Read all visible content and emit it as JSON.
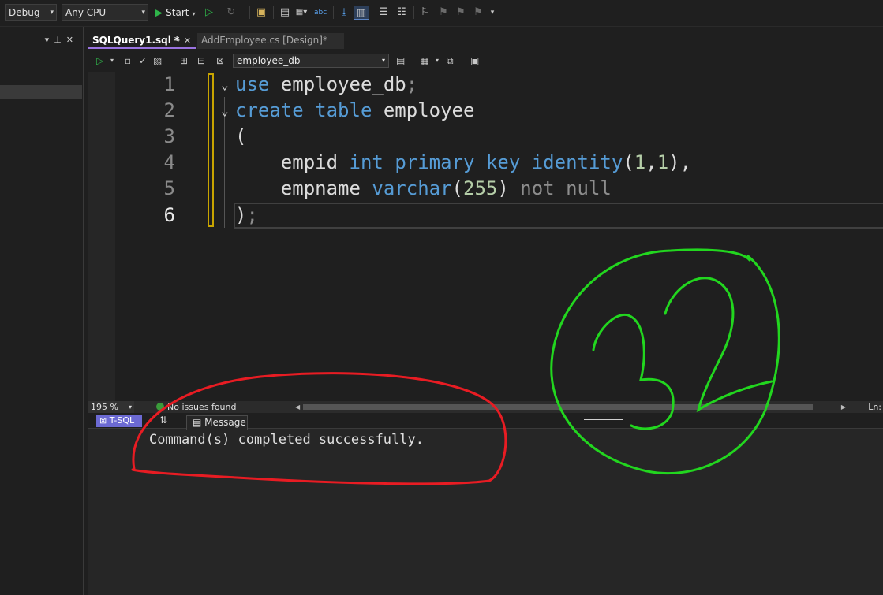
{
  "toolbar": {
    "config": "Debug",
    "platform": "Any CPU",
    "start_label": "Start"
  },
  "tabs": [
    {
      "label": "SQLQuery1.sql *",
      "active": true
    },
    {
      "label": "AddEmployee.cs [Design]*",
      "active": false
    }
  ],
  "query_toolbar": {
    "database": "employee_db"
  },
  "editor": {
    "line_numbers": [
      "1",
      "2",
      "3",
      "4",
      "5",
      "6"
    ],
    "current_line": 6,
    "lines": [
      "use employee_db;",
      "create table employee",
      "(",
      "    empid int primary key identity(1,1),",
      "    empname varchar(255) not null",
      ");"
    ]
  },
  "status": {
    "zoom": "195 %",
    "issues": "No issues found",
    "position_label": "Ln:"
  },
  "results": {
    "tsql_tab": "T-SQL",
    "message_tab": "Message",
    "message": "Command(s) completed successfully."
  },
  "annotation_text": "32",
  "colors": {
    "accent": "#9a73e0",
    "keyword": "#569cd6",
    "number": "#b5cea8",
    "red_annotation": "#e81c23",
    "green_annotation": "#22d61f"
  }
}
